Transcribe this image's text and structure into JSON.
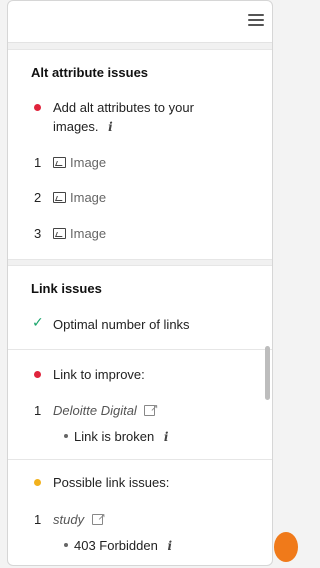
{
  "alt_section": {
    "title": "Alt attribute issues",
    "issue_text_line1": "Add alt attributes to your",
    "issue_text_line2": "images.",
    "items": [
      {
        "num": "1",
        "label": "Image"
      },
      {
        "num": "2",
        "label": "Image"
      },
      {
        "num": "3",
        "label": "Image"
      }
    ]
  },
  "link_section": {
    "title": "Link issues",
    "optimal_text": "Optimal number of links",
    "improve_title": "Link to improve:",
    "improve_item": {
      "num": "1",
      "link": "Deloitte Digital",
      "detail": "Link is broken"
    },
    "possible_title": "Possible link issues:",
    "possible_item": {
      "num": "1",
      "link": "study",
      "detail": "403 Forbidden"
    }
  },
  "icons": {
    "info": "i",
    "check": "✓"
  },
  "colors": {
    "error_dot": "#e0243c",
    "warning_dot": "#f2b11c",
    "success_check": "#1aa56c"
  }
}
